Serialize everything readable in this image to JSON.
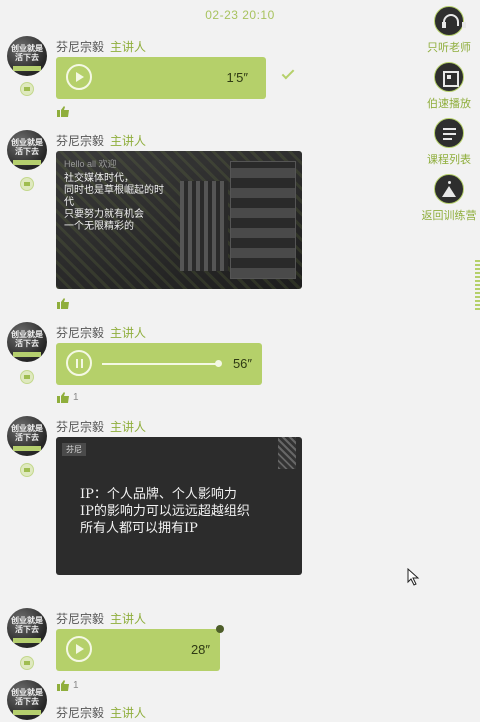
{
  "timestamp": "02-23 20:10",
  "speaker": {
    "name": "芬尼宗毅",
    "role": "主讲人",
    "avatar_text": "创业就是 活下去"
  },
  "messages": [
    {
      "type": "voice",
      "duration": "1′5″",
      "playing": false,
      "sent": true,
      "likes": ""
    },
    {
      "type": "image",
      "slide_top": "Hello all 欢迎",
      "slide_lines": [
        "社交媒体时代，",
        "同时也是草根崛起的时代",
        "只要努力就有机会",
        "一个无限精彩的"
      ],
      "likes": ""
    },
    {
      "type": "voice",
      "duration": "56″",
      "playing": true,
      "progress": 1.0,
      "likes": "1"
    },
    {
      "type": "image",
      "slide_tag": "芬尼",
      "slide_lines": [
        "IP：个人品牌、个人影响力",
        "IP的影响力可以远远超越组织",
        "所有人都可以拥有IP"
      ],
      "likes": ""
    },
    {
      "type": "voice",
      "duration": "28″",
      "playing": false,
      "unread": true,
      "likes": "1"
    },
    {
      "type": "voice",
      "duration": "",
      "playing": false,
      "likes": ""
    }
  ],
  "sidebar": [
    {
      "label": "只听老师",
      "icon": "headphones-icon"
    },
    {
      "label": "伯速播放",
      "icon": "screen-icon"
    },
    {
      "label": "课程列表",
      "icon": "list-icon"
    },
    {
      "label": "返回训练营",
      "icon": "exit-icon"
    }
  ],
  "colors": {
    "accent": "#b5d06a",
    "bubble": "#b5d06a",
    "background": "#f2f2f2",
    "dark": "#2e2e2e"
  }
}
